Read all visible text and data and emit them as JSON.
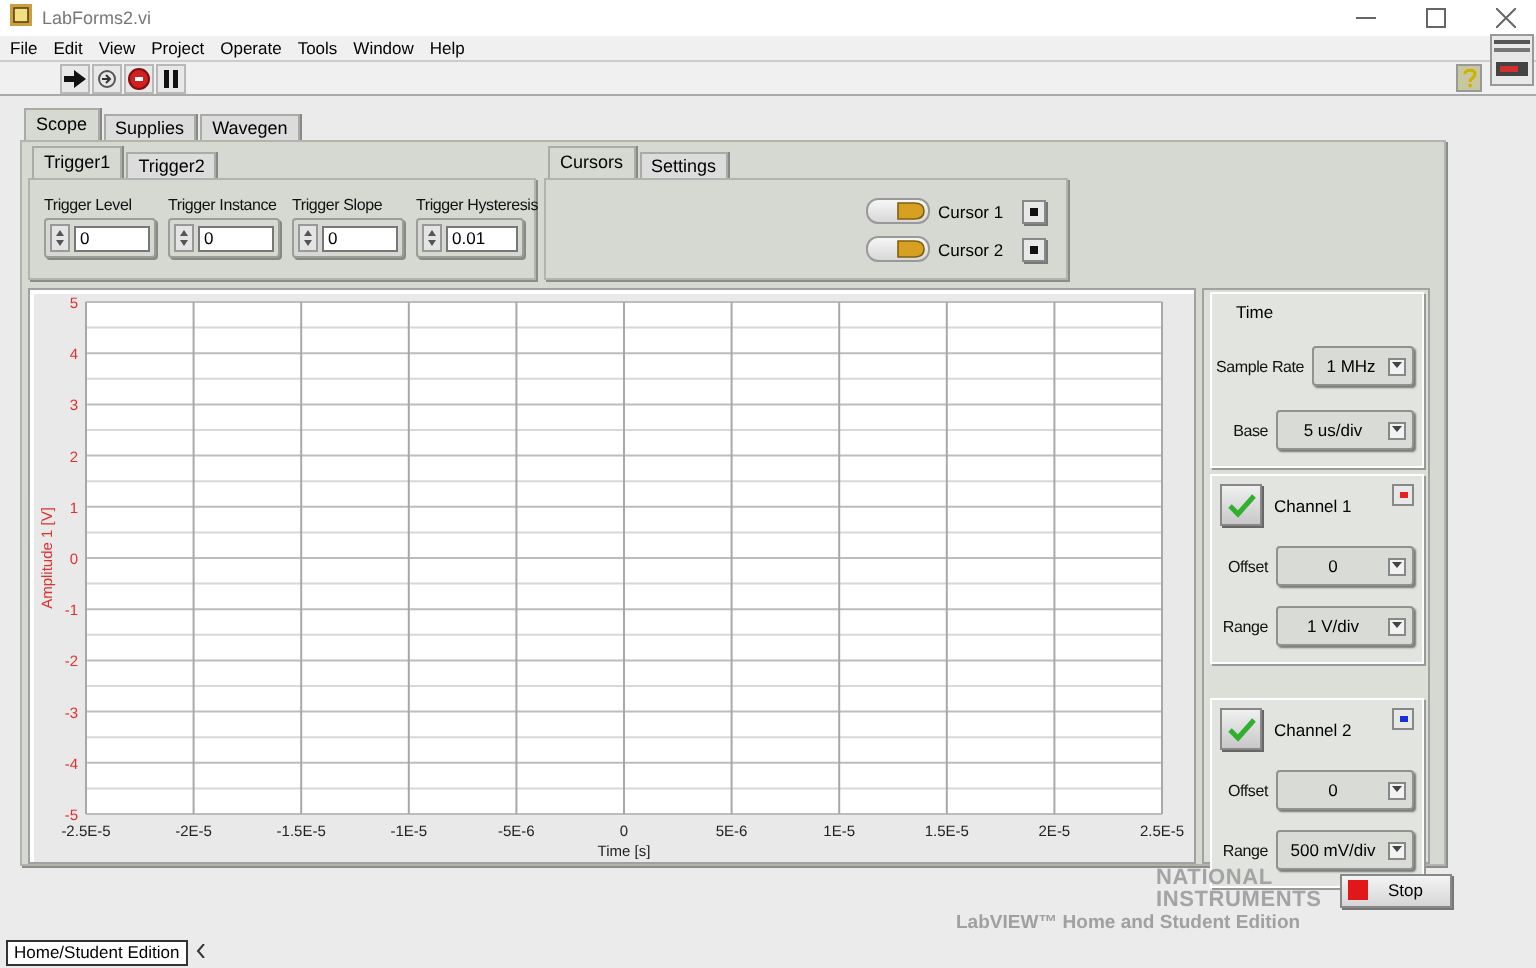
{
  "window": {
    "title": "LabForms2.vi"
  },
  "menu": [
    "File",
    "Edit",
    "View",
    "Project",
    "Operate",
    "Tools",
    "Window",
    "Help"
  ],
  "main_tabs": [
    {
      "label": "Scope",
      "selected": true
    },
    {
      "label": "Supplies",
      "selected": false
    },
    {
      "label": "Wavegen",
      "selected": false
    }
  ],
  "trigger_tabs": [
    {
      "label": "Trigger1",
      "selected": true
    },
    {
      "label": "Trigger2",
      "selected": false
    }
  ],
  "trigger_controls": [
    {
      "label": "Trigger Level",
      "value": "0"
    },
    {
      "label": "Trigger Instance",
      "value": "0"
    },
    {
      "label": "Trigger Slope",
      "value": "0"
    },
    {
      "label": "Trigger Hysteresis",
      "value": "0.01"
    }
  ],
  "cursor_tabs": [
    {
      "label": "Cursors",
      "selected": true
    },
    {
      "label": "Settings",
      "selected": false
    }
  ],
  "cursors": [
    {
      "label": "Cursor 1",
      "on": true
    },
    {
      "label": "Cursor 2",
      "on": true
    }
  ],
  "graph": {
    "chart_data": {
      "type": "line",
      "grid": true,
      "xlabel": "Time [s]",
      "ylabel": "Amplitude 1 [V]",
      "xlim": [
        -2.5e-05,
        2.5e-05
      ],
      "ylim": [
        -5,
        5
      ],
      "xticks": [
        {
          "value": -2.5e-05,
          "label": "-2.5E-5"
        },
        {
          "value": -2e-05,
          "label": "-2E-5"
        },
        {
          "value": -1.5e-05,
          "label": "-1.5E-5"
        },
        {
          "value": -1e-05,
          "label": "-1E-5"
        },
        {
          "value": -5e-06,
          "label": "-5E-6"
        },
        {
          "value": 0,
          "label": "0"
        },
        {
          "value": 5e-06,
          "label": "5E-6"
        },
        {
          "value": 1e-05,
          "label": "1E-5"
        },
        {
          "value": 1.5e-05,
          "label": "1.5E-5"
        },
        {
          "value": 2e-05,
          "label": "2E-5"
        },
        {
          "value": 2.5e-05,
          "label": "2.5E-5"
        }
      ],
      "yticks": [
        -5,
        -4,
        -3,
        -2,
        -1,
        0,
        1,
        2,
        3,
        4,
        5
      ]
    }
  },
  "time": {
    "title": "Time",
    "controls": [
      {
        "label": "Sample Rate",
        "value": "1 MHz"
      },
      {
        "label": "Base",
        "value": "5 us/div"
      }
    ]
  },
  "channels": [
    {
      "name": "Channel 1",
      "enabled": true,
      "color": "#e82020",
      "controls": [
        {
          "label": "Offset",
          "value": "0"
        },
        {
          "label": "Range",
          "value": "1 V/div"
        }
      ]
    },
    {
      "name": "Channel 2",
      "enabled": true,
      "color": "#1830d8",
      "controls": [
        {
          "label": "Offset",
          "value": "0"
        },
        {
          "label": "Range",
          "value": "500 mV/div"
        }
      ]
    }
  ],
  "stop_button": {
    "label": "Stop"
  },
  "watermark": {
    "brand": "NATIONAL INSTRUMENTS",
    "product": "LabVIEW™ Home and Student Edition"
  },
  "status_bar": {
    "edition": "Home/Student Edition"
  }
}
